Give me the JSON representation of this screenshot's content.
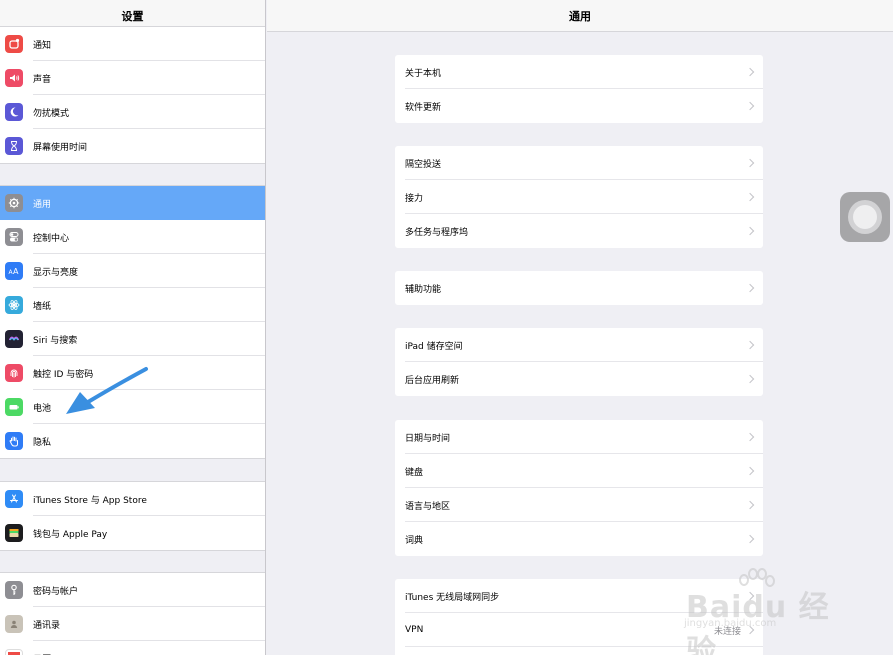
{
  "sidebar": {
    "title": "设置",
    "group1": [
      {
        "label": "通知",
        "icon": "notifications-icon",
        "color": "#ee4b46"
      },
      {
        "label": "声音",
        "icon": "sounds-icon",
        "color": "#ee4b66"
      },
      {
        "label": "勿扰模式",
        "icon": "moon-icon",
        "color": "#5b58d6"
      },
      {
        "label": "屏幕使用时间",
        "icon": "hourglass-icon",
        "color": "#5b58d6"
      }
    ],
    "group2": [
      {
        "label": "通用",
        "icon": "gear-icon",
        "color": "#8e8e93"
      },
      {
        "label": "控制中心",
        "icon": "switches-icon",
        "color": "#8e8e93"
      },
      {
        "label": "显示与亮度",
        "icon": "display-icon",
        "color": "#2f7cf6"
      },
      {
        "label": "墙纸",
        "icon": "wallpaper-icon",
        "color": "#36aadc"
      },
      {
        "label": "Siri 与搜索",
        "icon": "siri-icon",
        "color": "#222233"
      },
      {
        "label": "触控 ID 与密码",
        "icon": "fingerprint-icon",
        "color": "#ee4b66"
      },
      {
        "label": "电池",
        "icon": "battery-icon",
        "color": "#4cd964"
      },
      {
        "label": "隐私",
        "icon": "hand-icon",
        "color": "#2f7cf6"
      }
    ],
    "group3": [
      {
        "label": "iTunes Store 与 App Store",
        "icon": "appstore-icon",
        "color": "#2f8cf6"
      },
      {
        "label": "钱包与 Apple Pay",
        "icon": "wallet-icon",
        "color": "#1c1c1e"
      }
    ],
    "group4": [
      {
        "label": "密码与帐户",
        "icon": "key-icon",
        "color": "#8e8e93"
      },
      {
        "label": "通讯录",
        "icon": "contacts-icon",
        "color": "#c9c3b8"
      },
      {
        "label": "日历",
        "icon": "calendar-icon",
        "color": "#ee4b46"
      }
    ],
    "selected": "通用"
  },
  "detail": {
    "title": "通用",
    "groups": [
      [
        "关于本机",
        "软件更新"
      ],
      [
        "隔空投送",
        "接力",
        "多任务与程序坞"
      ],
      [
        "辅助功能"
      ],
      [
        "iPad 储存空间",
        "后台应用刷新"
      ],
      [
        "日期与时间",
        "键盘",
        "语言与地区",
        "词典"
      ],
      [
        "iTunes 无线局域网同步",
        "VPN",
        ""
      ]
    ],
    "vpn_status": "未连接"
  },
  "watermark": {
    "text": "Baidu 经验",
    "sub": "jingyan.baidu.com"
  },
  "colors": {
    "accent": "#65a8f8",
    "arrow": "#3a8fe0"
  }
}
